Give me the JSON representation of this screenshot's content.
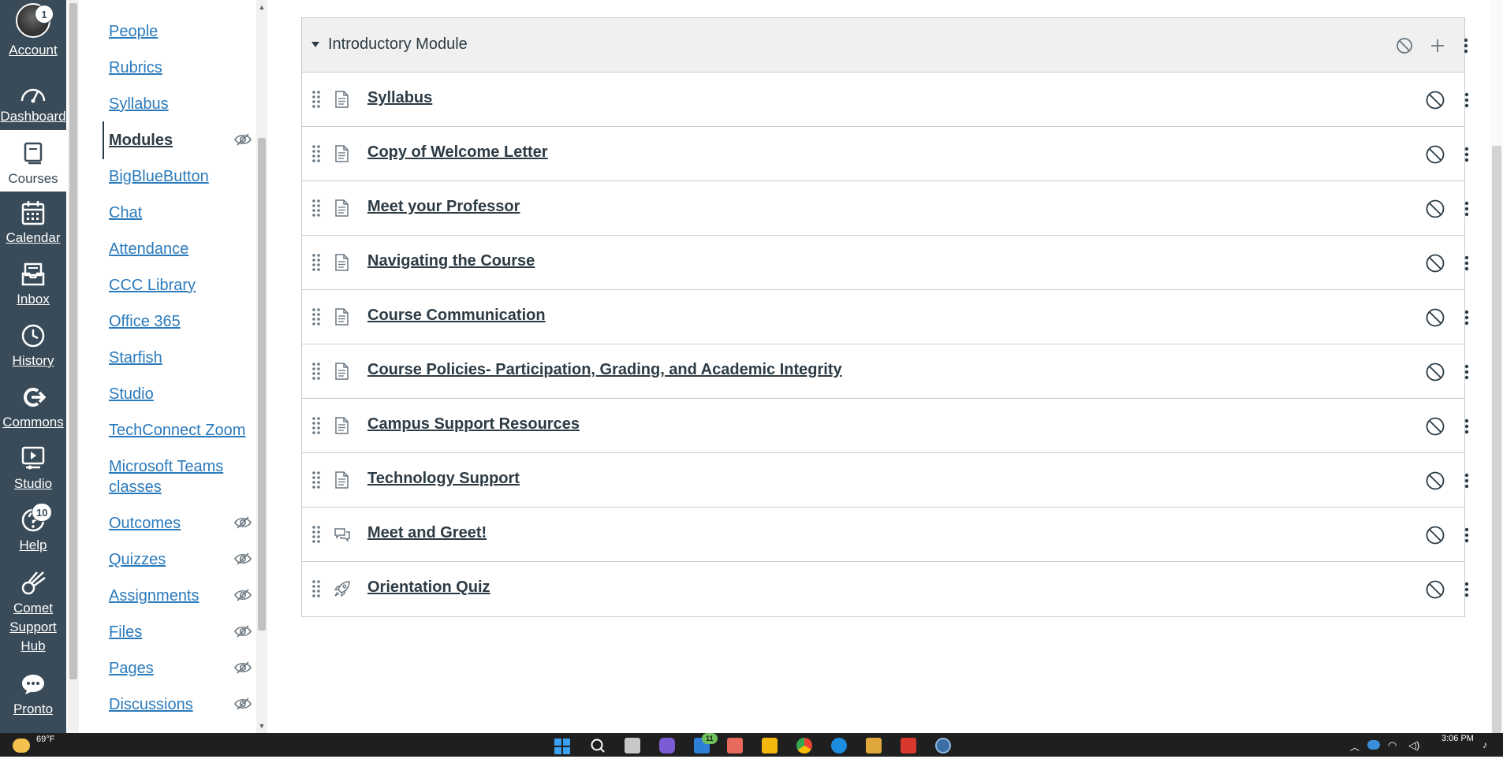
{
  "global_nav": {
    "account": {
      "label": "Account",
      "badge": "1"
    },
    "dashboard": {
      "label": "Dashboard"
    },
    "courses": {
      "label": "Courses"
    },
    "calendar": {
      "label": "Calendar"
    },
    "inbox": {
      "label": "Inbox"
    },
    "history": {
      "label": "History"
    },
    "commons": {
      "label": "Commons"
    },
    "studio": {
      "label": "Studio"
    },
    "help": {
      "label": "Help",
      "badge": "10"
    },
    "comet": {
      "label_line1": "Comet",
      "label_line2": "Support",
      "label_line3": "Hub"
    },
    "pronto": {
      "label": "Pronto"
    }
  },
  "course_nav": {
    "items": [
      {
        "label": "People"
      },
      {
        "label": "Rubrics"
      },
      {
        "label": "Syllabus"
      },
      {
        "label": "Modules"
      },
      {
        "label": "BigBlueButton"
      },
      {
        "label": "Chat"
      },
      {
        "label": "Attendance"
      },
      {
        "label": "CCC Library"
      },
      {
        "label": "Office 365"
      },
      {
        "label": "Starfish"
      },
      {
        "label": "Studio"
      },
      {
        "label": "TechConnect Zoom"
      },
      {
        "label_line1": "Microsoft Teams",
        "label_line2": "classes"
      },
      {
        "label": "Outcomes"
      },
      {
        "label": "Quizzes"
      },
      {
        "label": "Assignments"
      },
      {
        "label": "Files"
      },
      {
        "label": "Pages"
      },
      {
        "label": "Discussions"
      }
    ]
  },
  "module": {
    "title": "Introductory Module",
    "items": [
      {
        "title": "Syllabus",
        "type": "page-icon"
      },
      {
        "title": "Copy of Welcome Letter",
        "type": "page-icon"
      },
      {
        "title": "Meet your Professor",
        "type": "page-icon"
      },
      {
        "title": "Navigating the Course",
        "type": "page-icon"
      },
      {
        "title": "Course Communication",
        "type": "page-icon"
      },
      {
        "title": "Course Policies- Participation, Grading, and Academic Integrity",
        "type": "page-icon"
      },
      {
        "title": "Campus Support Resources",
        "type": "page-icon"
      },
      {
        "title": "Technology Support",
        "type": "page-icon"
      },
      {
        "title": "Meet and Greet!",
        "type": "discussion-icon"
      },
      {
        "title": "Orientation Quiz",
        "type": "quiz-rocket-icon"
      }
    ]
  },
  "taskbar": {
    "weather": "69°F",
    "mail_badge": "11",
    "time": "3:06 PM"
  },
  "colors": {
    "global_nav_bg": "#394b58",
    "link": "#2b7abc",
    "text": "#2d3b45",
    "module_header_bg": "#f0f0f0"
  }
}
